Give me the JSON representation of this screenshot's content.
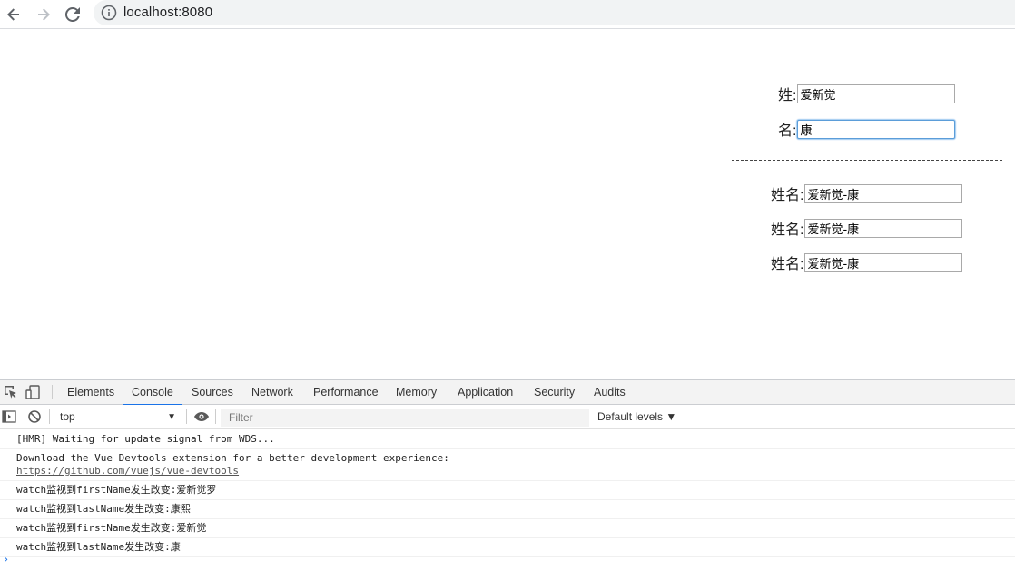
{
  "browser": {
    "url": "localhost:8080"
  },
  "form": {
    "last_name_label": "姓:",
    "last_name_value": "爱新觉",
    "first_name_label": "名:",
    "first_name_value": "康",
    "divider": "-----------------------------------------------------------------",
    "full_name_rows": [
      {
        "label": "姓名:",
        "value": "爱新觉-康"
      },
      {
        "label": "姓名:",
        "value": "爱新觉-康"
      },
      {
        "label": "姓名:",
        "value": "爱新觉-康"
      }
    ]
  },
  "devtools": {
    "tabs": [
      "Elements",
      "Console",
      "Sources",
      "Network",
      "Performance",
      "Memory",
      "Application",
      "Security",
      "Audits"
    ],
    "active_tab": "Console",
    "context": "top",
    "filter_placeholder": "Filter",
    "levels": "Default levels ▼",
    "messages": [
      {
        "text": "[HMR] Waiting for update signal from WDS..."
      },
      {
        "text": "Download the Vue Devtools extension for a better development experience:",
        "link": "https://github.com/vuejs/vue-devtools"
      },
      {
        "text": "watch监视到firstName发生改变:爱新觉罗"
      },
      {
        "text": "watch监视到lastName发生改变:康熙"
      },
      {
        "text": "watch监视到firstName发生改变:爱新觉"
      },
      {
        "text": "watch监视到lastName发生改变:康"
      }
    ],
    "prompt": "›"
  },
  "icons": {
    "back": "arrow-left-icon",
    "forward": "arrow-right-icon",
    "reload": "reload-icon",
    "info": "info-icon",
    "inspect": "inspect-element-icon",
    "device": "device-toolbar-icon",
    "sidebar": "console-sidebar-icon",
    "clear": "clear-console-icon",
    "eye": "eye-icon"
  }
}
